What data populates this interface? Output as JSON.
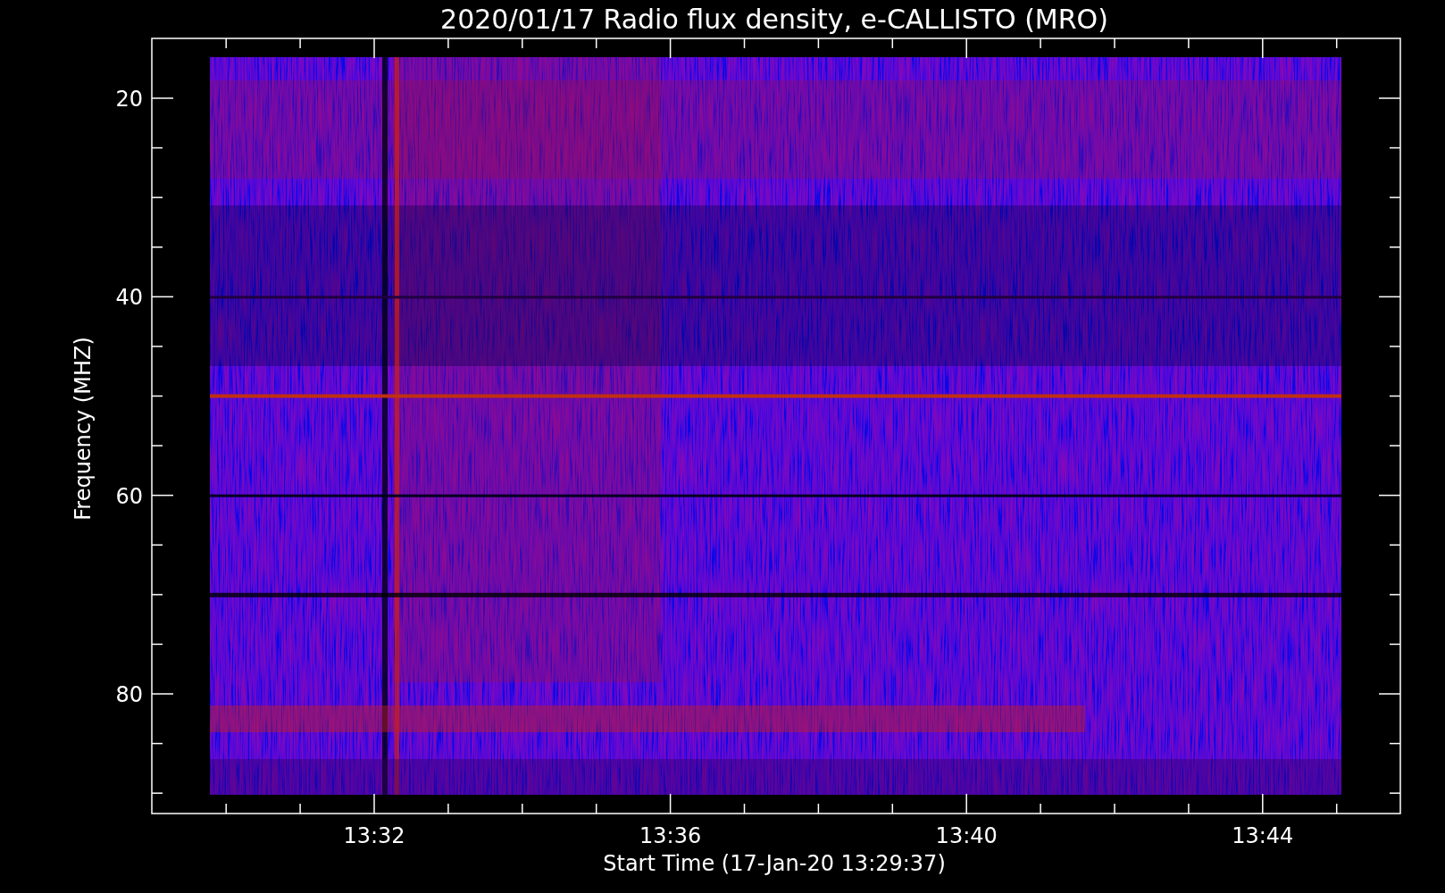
{
  "title": "2020/01/17  Radio flux density, e-CALLISTO (MRO)",
  "ylabel": "Frequency (MHZ)",
  "xlabel": "Start Time (17-Jan-20 13:29:37)",
  "yticks": [
    "20",
    "40",
    "60",
    "80"
  ],
  "xticks": [
    "13:32",
    "13:36",
    "13:40",
    "13:44"
  ]
}
